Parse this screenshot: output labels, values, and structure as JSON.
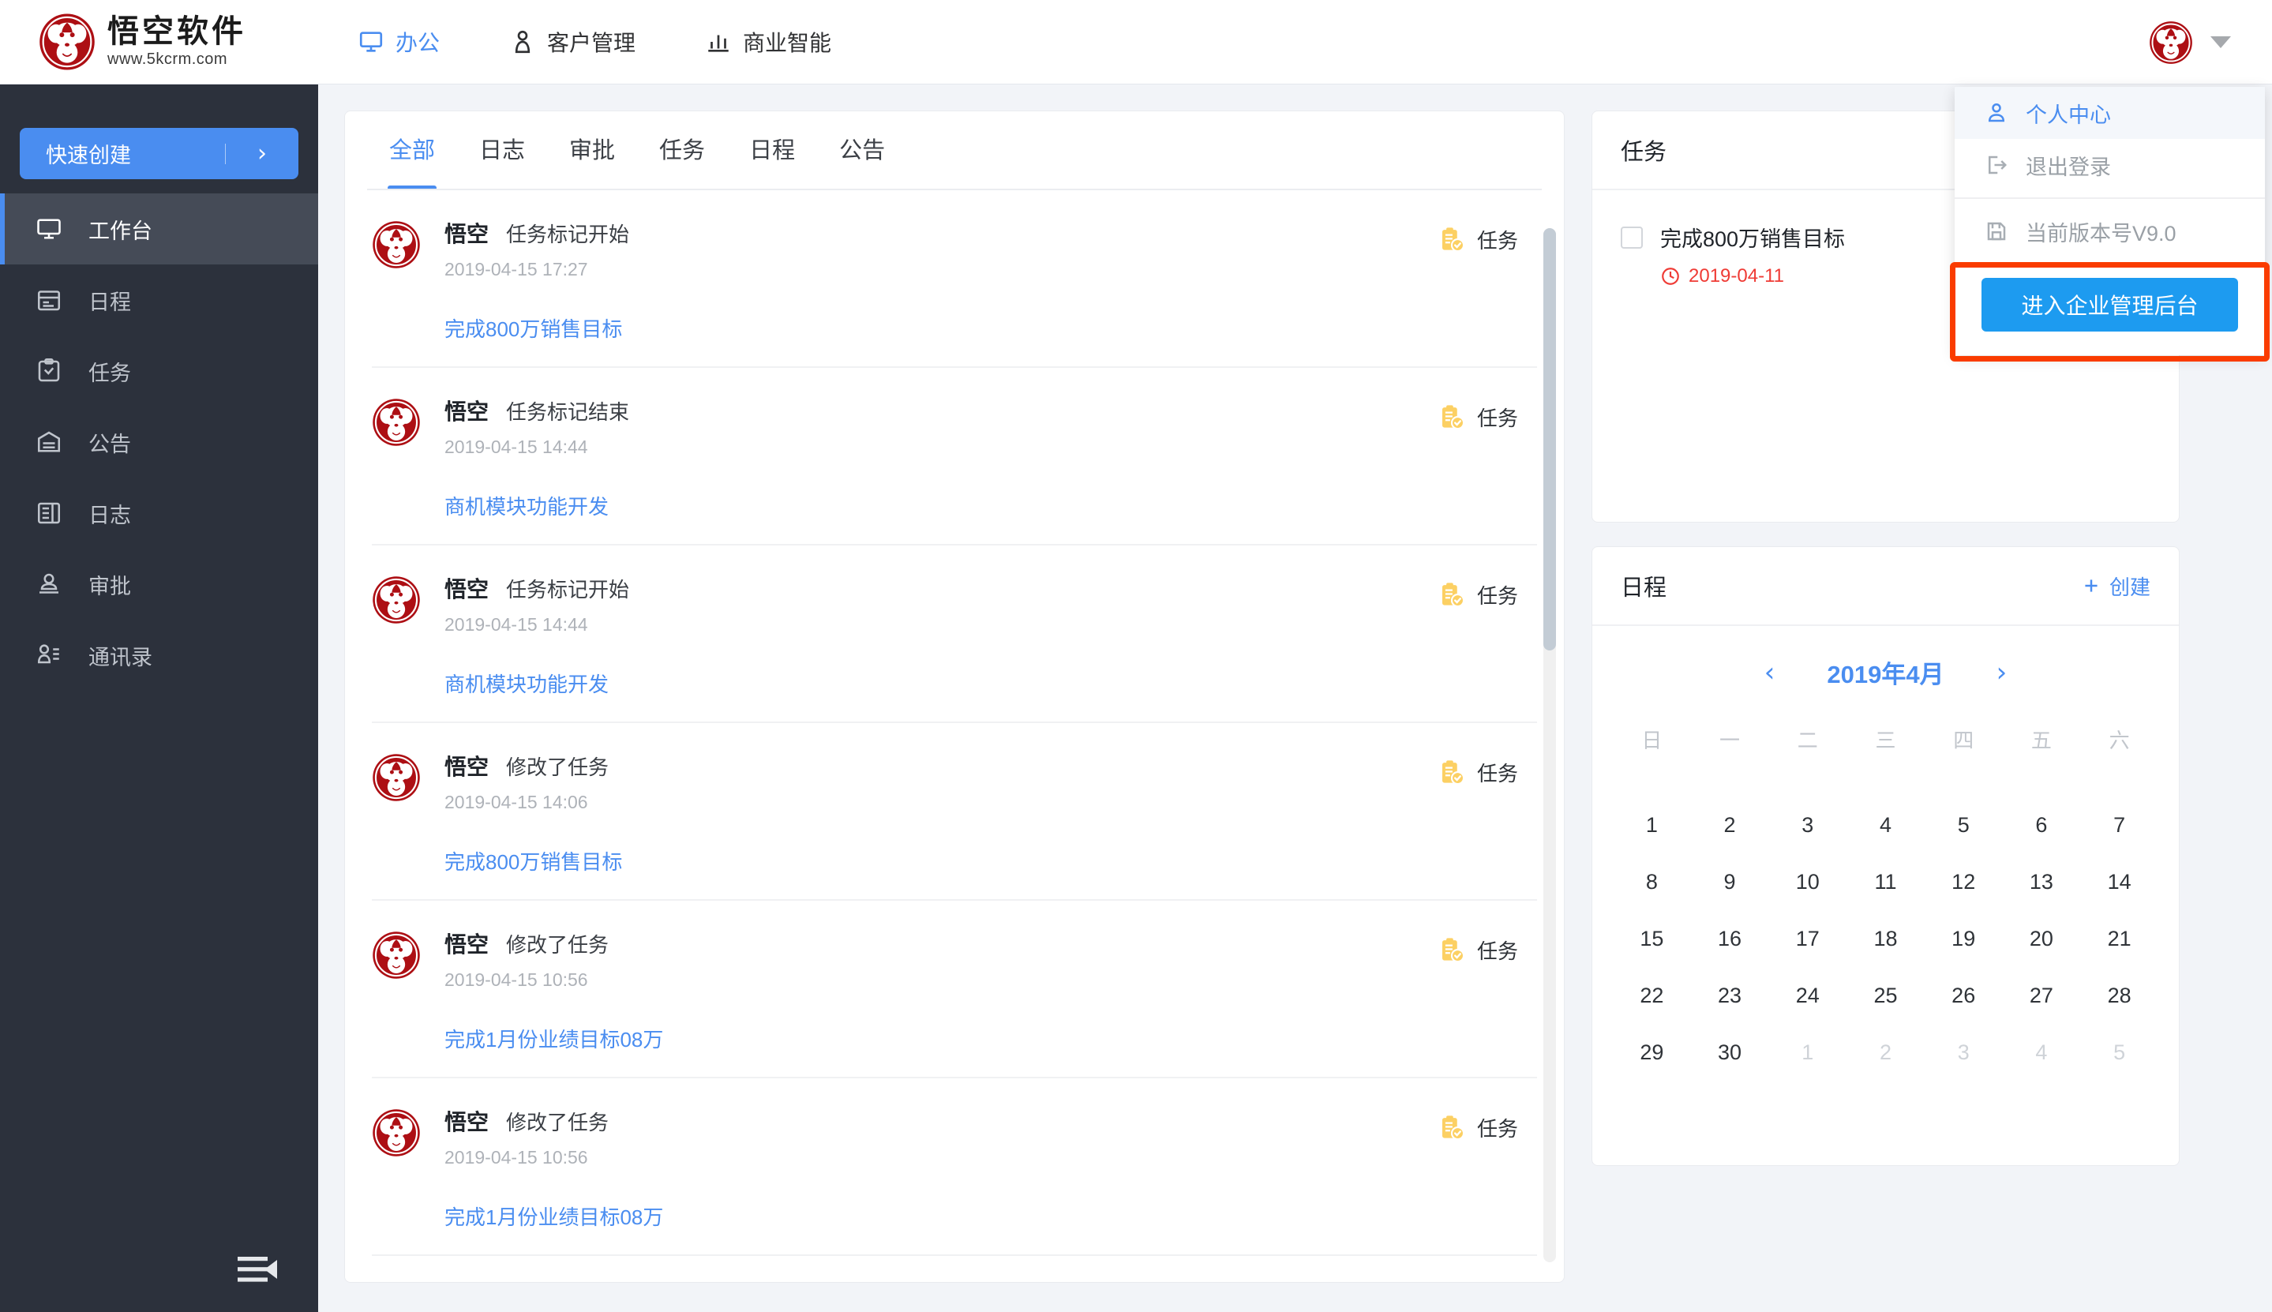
{
  "brand": {
    "name": "悟空软件",
    "url": "www.5kcrm.com",
    "logo_icon": "monkey-logo-icon"
  },
  "header": {
    "nav": [
      {
        "label": "办公",
        "icon": "monitor-icon",
        "active": true
      },
      {
        "label": "客户管理",
        "icon": "person-icon",
        "active": false
      },
      {
        "label": "商业智能",
        "icon": "bar-chart-icon",
        "active": false
      }
    ],
    "avatar_icon": "monkey-avatar-icon",
    "caret_icon": "chevron-down-icon"
  },
  "user_menu": {
    "items": [
      {
        "label": "个人中心",
        "icon": "user-icon",
        "state": "highlight"
      },
      {
        "label": "退出登录",
        "icon": "logout-icon",
        "state": "plain"
      },
      {
        "label": "当前版本号V9.0",
        "icon": "save-disk-icon",
        "state": "plain"
      }
    ],
    "cta_label": "进入企业管理后台",
    "cta_color": "#1d9bf0",
    "highlight_color": "#fa3c00"
  },
  "sidebar": {
    "quick_create": {
      "label": "快速创建",
      "arrow": "›",
      "color": "#4a8df0"
    },
    "items": [
      {
        "label": "工作台",
        "icon": "workbench-monitor-icon",
        "active": true
      },
      {
        "label": "日程",
        "icon": "calendar-icon",
        "active": false
      },
      {
        "label": "任务",
        "icon": "task-clipboard-icon",
        "active": false
      },
      {
        "label": "公告",
        "icon": "announcement-icon",
        "active": false
      },
      {
        "label": "日志",
        "icon": "journal-icon",
        "active": false
      },
      {
        "label": "审批",
        "icon": "approval-stamp-icon",
        "active": false
      },
      {
        "label": "通讯录",
        "icon": "contacts-icon",
        "active": false
      }
    ],
    "collapse_icon": "collapse-sidebar-icon"
  },
  "feed": {
    "tabs": [
      {
        "label": "全部",
        "active": true
      },
      {
        "label": "日志",
        "active": false
      },
      {
        "label": "审批",
        "active": false
      },
      {
        "label": "任务",
        "active": false
      },
      {
        "label": "日程",
        "active": false
      },
      {
        "label": "公告",
        "active": false
      }
    ],
    "items": [
      {
        "user": "悟空",
        "action": "任务标记开始",
        "time": "2019-04-15 17:27",
        "link": "完成800万销售目标",
        "tag": "任务",
        "tag_icon": "task-clipboard-check-icon",
        "avatar_icon": "monkey-avatar-icon"
      },
      {
        "user": "悟空",
        "action": "任务标记结束",
        "time": "2019-04-15 14:44",
        "link": "商机模块功能开发",
        "tag": "任务",
        "tag_icon": "task-clipboard-check-icon",
        "avatar_icon": "monkey-avatar-icon"
      },
      {
        "user": "悟空",
        "action": "任务标记开始",
        "time": "2019-04-15 14:44",
        "link": "商机模块功能开发",
        "tag": "任务",
        "tag_icon": "task-clipboard-check-icon",
        "avatar_icon": "monkey-avatar-icon"
      },
      {
        "user": "悟空",
        "action": "修改了任务",
        "time": "2019-04-15 14:06",
        "link": "完成800万销售目标",
        "tag": "任务",
        "tag_icon": "task-clipboard-check-icon",
        "avatar_icon": "monkey-avatar-icon"
      },
      {
        "user": "悟空",
        "action": "修改了任务",
        "time": "2019-04-15 10:56",
        "link": "完成1月份业绩目标08万",
        "tag": "任务",
        "tag_icon": "task-clipboard-check-icon",
        "avatar_icon": "monkey-avatar-icon"
      },
      {
        "user": "悟空",
        "action": "修改了任务",
        "time": "2019-04-15 10:56",
        "link": "完成1月份业绩目标08万",
        "tag": "任务",
        "tag_icon": "task-clipboard-check-icon",
        "avatar_icon": "monkey-avatar-icon"
      }
    ]
  },
  "task_panel": {
    "title": "任务",
    "items": [
      {
        "name": "完成800万销售目标",
        "due": "2019-04-11",
        "due_icon": "clock-icon",
        "due_color": "#ef3b35",
        "checked": false
      }
    ]
  },
  "schedule_panel": {
    "title": "日程",
    "create_label": "创建",
    "create_icon": "plus-icon",
    "prev_icon": "chevron-left-icon",
    "next_icon": "chevron-right-icon",
    "month_label": "2019年4月",
    "dow": [
      "日",
      "一",
      "二",
      "三",
      "四",
      "五",
      "六"
    ],
    "weeks": [
      [
        {
          "d": "1",
          "muted": false
        },
        {
          "d": "2",
          "muted": false
        },
        {
          "d": "3",
          "muted": false
        },
        {
          "d": "4",
          "muted": false
        },
        {
          "d": "5",
          "muted": false
        },
        {
          "d": "6",
          "muted": false
        },
        {
          "d": "7",
          "muted": false
        }
      ],
      [
        {
          "d": "8",
          "muted": false
        },
        {
          "d": "9",
          "muted": false
        },
        {
          "d": "10",
          "muted": false
        },
        {
          "d": "11",
          "muted": false
        },
        {
          "d": "12",
          "muted": false
        },
        {
          "d": "13",
          "muted": false
        },
        {
          "d": "14",
          "muted": false
        }
      ],
      [
        {
          "d": "15",
          "muted": false
        },
        {
          "d": "16",
          "muted": false
        },
        {
          "d": "17",
          "muted": false
        },
        {
          "d": "18",
          "muted": false
        },
        {
          "d": "19",
          "muted": false
        },
        {
          "d": "20",
          "muted": false
        },
        {
          "d": "21",
          "muted": false
        }
      ],
      [
        {
          "d": "22",
          "muted": false
        },
        {
          "d": "23",
          "muted": false
        },
        {
          "d": "24",
          "muted": false
        },
        {
          "d": "25",
          "muted": false
        },
        {
          "d": "26",
          "muted": false
        },
        {
          "d": "27",
          "muted": false
        },
        {
          "d": "28",
          "muted": false
        }
      ],
      [
        {
          "d": "29",
          "muted": false
        },
        {
          "d": "30",
          "muted": false
        },
        {
          "d": "1",
          "muted": true
        },
        {
          "d": "2",
          "muted": true
        },
        {
          "d": "3",
          "muted": true
        },
        {
          "d": "4",
          "muted": true
        },
        {
          "d": "5",
          "muted": true
        }
      ]
    ]
  }
}
